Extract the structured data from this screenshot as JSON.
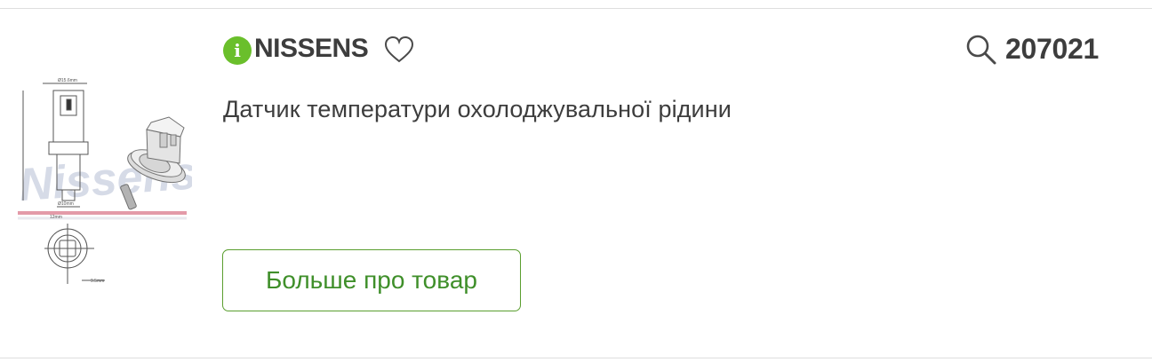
{
  "product": {
    "info_icon_glyph": "i",
    "brand": "NISSENS",
    "article_number": "207021",
    "description": "Датчик температури охолоджувальної рідини",
    "more_button_label": "Больше про товар",
    "image_watermark": "Nissens"
  },
  "colors": {
    "accent_green": "#6abf2b",
    "button_border": "#5a9e2f",
    "button_text": "#3f8f2a",
    "text_dark": "#3d3d3d"
  },
  "icons": [
    "info-icon",
    "heart-icon",
    "search-icon"
  ]
}
